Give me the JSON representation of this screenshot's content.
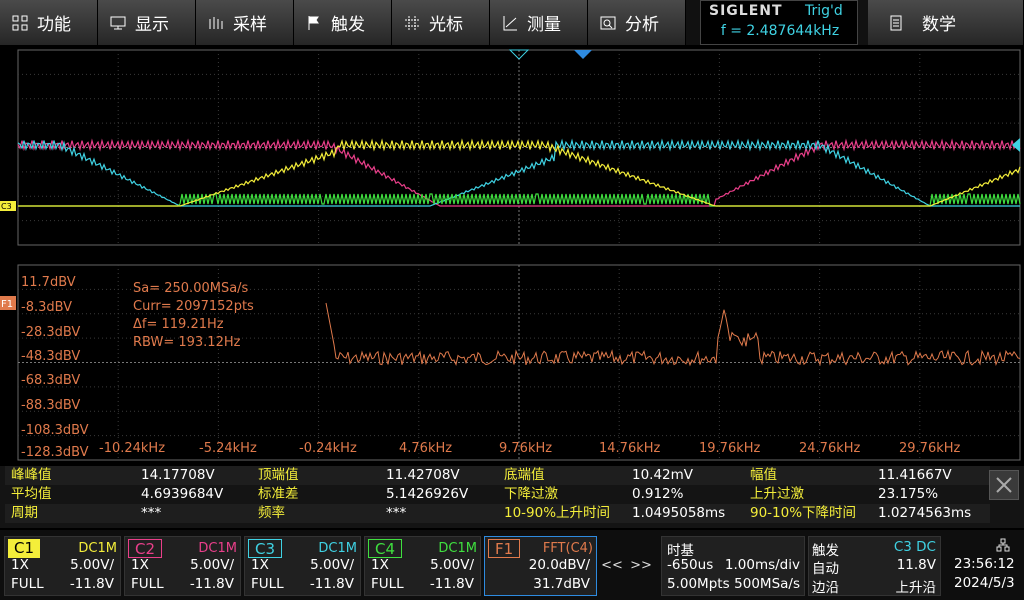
{
  "menu": [
    {
      "icon": "grid-icon",
      "label": "功能"
    },
    {
      "icon": "display-icon",
      "label": "显示"
    },
    {
      "icon": "sample-icon",
      "label": "采样"
    },
    {
      "icon": "flag-icon",
      "label": "触发"
    },
    {
      "icon": "cursor-icon",
      "label": "光标"
    },
    {
      "icon": "measure-icon",
      "label": "测量"
    },
    {
      "icon": "analysis-icon",
      "label": "分析"
    }
  ],
  "brand": {
    "name": "SIGLENT",
    "status": "Trig'd",
    "freq": "f = 2.487644kHz"
  },
  "math_menu": {
    "icon": "document-icon",
    "label": "数学"
  },
  "waveform": {
    "channel_marker": "C3",
    "fft_marker": "F1",
    "colors": {
      "c1": "#f4ee3a",
      "c2": "#ea3f8a",
      "c3": "#3fd2e3",
      "c4": "#3fe03f",
      "fft": "#e07a4c"
    }
  },
  "fft": {
    "info": [
      "Sa=  250.00MSa/s",
      "Curr= 2097152pts",
      "Δf=  119.21Hz",
      "RBW=  193.12Hz"
    ],
    "y_ticks": [
      "11.7dBV",
      "-8.3dBV",
      "-28.3dBV",
      "-48.3dBV",
      "-68.3dBV",
      "-88.3dBV",
      "-108.3dBV",
      "-128.3dBV"
    ],
    "x_ticks": [
      "-10.24kHz",
      "-5.24kHz",
      "-0.24kHz",
      "4.76kHz",
      "9.76kHz",
      "14.76kHz",
      "19.76kHz",
      "24.76kHz",
      "29.76kHz"
    ]
  },
  "measurements": [
    [
      {
        "name": "峰峰值",
        "value": "14.17708V"
      },
      {
        "name": "顶端值",
        "value": "11.42708V"
      },
      {
        "name": "底端值",
        "value": "10.42mV"
      },
      {
        "name": "幅值",
        "value": "11.41667V"
      }
    ],
    [
      {
        "name": "平均值",
        "value": "4.6939684V"
      },
      {
        "name": "标准差",
        "value": "5.1426926V"
      },
      {
        "name": "下降过激",
        "value": "0.912%"
      },
      {
        "name": "上升过激",
        "value": "23.175%"
      }
    ],
    [
      {
        "name": "周期",
        "value": "***"
      },
      {
        "name": "频率",
        "value": "***"
      },
      {
        "name": "10-90%上升时间",
        "value": "1.0495058ms"
      },
      {
        "name": "90-10%下降时间",
        "value": "1.0274563ms"
      }
    ]
  ],
  "channels": [
    {
      "name": "C1",
      "coupling": "DC1M",
      "probe": "1X",
      "scale": "5.00V/",
      "bw": "FULL",
      "offset": "-11.8V",
      "color": "#f4ee3a"
    },
    {
      "name": "C2",
      "coupling": "DC1M",
      "probe": "1X",
      "scale": "5.00V/",
      "bw": "FULL",
      "offset": "-11.8V",
      "color": "#ea3f8a"
    },
    {
      "name": "C3",
      "coupling": "DC1M",
      "probe": "1X",
      "scale": "5.00V/",
      "bw": "FULL",
      "offset": "-11.8V",
      "color": "#3fd2e3"
    },
    {
      "name": "C4",
      "coupling": "DC1M",
      "probe": "1X",
      "scale": "5.00V/",
      "bw": "FULL",
      "offset": "-11.8V",
      "color": "#3fe03f"
    }
  ],
  "math_channel": {
    "name": "F1",
    "source": "FFT(C4)",
    "scale": "20.0dBV/",
    "offset": "31.7dBV",
    "color": "#e07a4c"
  },
  "nav": {
    "left": "<<",
    "right": ">>"
  },
  "timebase": {
    "title": "时基",
    "delay": "-650us",
    "scale": "1.00ms/div",
    "points": "5.00Mpts",
    "rate": "500MSa/s"
  },
  "trigger": {
    "title": "触发",
    "source": "C3 DC",
    "mode": "自动",
    "level": "11.8V",
    "type": "边沿",
    "slope": "上升沿"
  },
  "status": {
    "time": "23:56:12",
    "date": "2024/5/3",
    "icon": "network-icon"
  }
}
